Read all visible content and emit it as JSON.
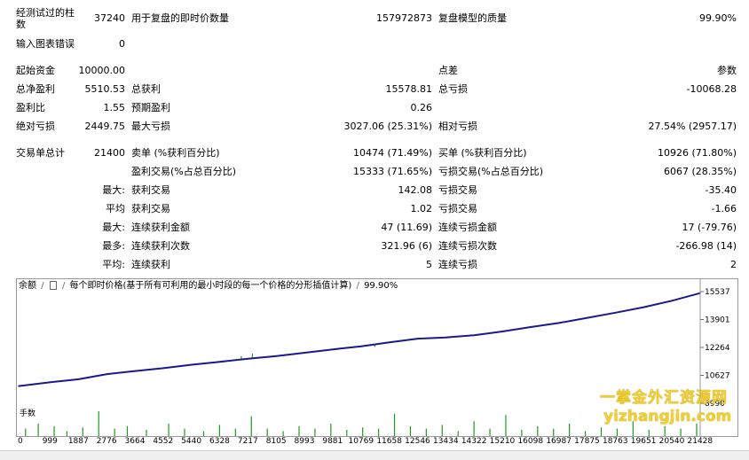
{
  "report": {
    "bars_tested_label": "经测试过的柱数",
    "bars_tested_label_line1": "经测试过的柱",
    "bars_tested_label_line2": "数",
    "bars_tested": "37240",
    "ticks_modelled_label": "用于复盘的即时价数量",
    "ticks_modelled": "157972873",
    "modelling_quality_label": "复盘模型的质量",
    "modelling_quality": "99.90%",
    "mismatched_errors_label": "输入图表错误",
    "mismatched_errors": "0",
    "initial_deposit_label": "起始资金",
    "initial_deposit": "10000.00",
    "spread_label": "点差",
    "spread": "参数",
    "total_net_profit_label": "总净盈利",
    "total_net_profit": "5510.53",
    "gross_profit_label": "总获利",
    "gross_profit": "15578.81",
    "gross_loss_label": "总亏损",
    "gross_loss": "-10068.28",
    "profit_factor_label": "盈利比",
    "profit_factor": "1.55",
    "expected_payoff_label": "预期盈利",
    "expected_payoff": "0.26",
    "absolute_drawdown_label": "绝对亏损",
    "absolute_drawdown": "2449.75",
    "maximal_drawdown_label": "最大亏损",
    "maximal_drawdown": "3027.06 (25.31%)",
    "relative_drawdown_label": "相对亏损",
    "relative_drawdown": "27.54% (2957.17)",
    "total_trades_label": "交易单总计",
    "total_trades": "21400",
    "short_positions_label": "卖单 (%获利百分比)",
    "short_positions": "10474 (71.49%)",
    "long_positions_label": "买单 (%获利百分比)",
    "long_positions": "10926 (71.80%)",
    "profit_trades_label": "盈利交易(%占总百分比)",
    "profit_trades": "15333 (71.65%)",
    "loss_trades_label": "亏损交易(%占总百分比)",
    "loss_trades": "6067 (28.35%)",
    "largest_label": "最大:",
    "largest_profit_label": "获利交易",
    "largest_profit": "142.08",
    "largest_loss_label": "亏损交易",
    "largest_loss": "-35.40",
    "average_label": "平均",
    "average_profit_label": "获利交易",
    "average_profit": "1.02",
    "average_loss_label": "亏损交易",
    "average_loss": "-1.66",
    "max_consec_label": "最大:",
    "max_consec_wins_label": "连续获利金额",
    "max_consec_wins": "47 (11.69)",
    "max_consec_losses_label": "连续亏损金额",
    "max_consec_losses": "17 (-79.76)",
    "maximal_consec_label": "最多:",
    "maximal_consec_profit_label": "连续获利次数",
    "maximal_consec_profit": "321.96 (6)",
    "maximal_consec_loss_label": "连续亏损次数",
    "maximal_consec_loss": "-266.98 (14)",
    "avg_consec_label": "平均:",
    "avg_consec_wins_label": "连续获利",
    "avg_consec_wins": "5",
    "avg_consec_losses_label": "连续亏损",
    "avg_consec_losses": "2"
  },
  "chart_header": {
    "balance": "余额",
    "model_text": "每个即时价格(基于所有可利用的最小时段的每一个价格的分形插值计算)",
    "quality": "99.90%"
  },
  "volume_label": "手数",
  "watermark": {
    "line1": "一掌金外汇资源网",
    "line2": "yizhangjin.com"
  },
  "colors": {
    "balance_line": "#1a1a8c",
    "volume_bars": "#1e9a1e",
    "drawdown_spikes": "#1e9a1e",
    "watermark": "#f2d02a"
  },
  "chart_data": {
    "type": "line",
    "title": "",
    "x_ticks": [
      "0",
      "999",
      "1887",
      "2776",
      "3664",
      "4552",
      "5440",
      "6328",
      "7217",
      "8105",
      "8993",
      "9881",
      "10769",
      "11658",
      "12546",
      "13434",
      "14322",
      "15210",
      "16098",
      "16987",
      "17875",
      "18763",
      "19651",
      "20540",
      "21428"
    ],
    "y_ticks": [
      "15537",
      "13901",
      "12264",
      "10627",
      "8990"
    ],
    "ylim": [
      8990,
      15537
    ],
    "xlim": [
      0,
      21428
    ],
    "series": [
      {
        "x": [
          0,
          999,
          1887,
          2776,
          3664,
          4552,
          5440,
          6328,
          7217,
          8105,
          8993,
          9881,
          10769,
          11658,
          12546,
          13434,
          14322,
          15210,
          16098,
          16987,
          17875,
          18763,
          19651,
          20540,
          21428
        ],
        "values": [
          10000,
          10220,
          10400,
          10700,
          10880,
          11050,
          11250,
          11420,
          11600,
          11760,
          11950,
          12150,
          12330,
          12560,
          12780,
          12850,
          12980,
          13200,
          13460,
          13700,
          14000,
          14300,
          14620,
          15000,
          15450
        ]
      }
    ],
    "spikes": [
      {
        "x": 2500,
        "low": 10627
      },
      {
        "x": 7000,
        "low": 11750
      },
      {
        "x": 7350,
        "low": 11900
      },
      {
        "x": 11200,
        "low": 12300
      }
    ],
    "volume": {
      "label": "手数",
      "x": [
        200,
        600,
        1100,
        1500,
        2000,
        2500,
        3000,
        3400,
        4000,
        4700,
        5200,
        5800,
        6300,
        6800,
        7300,
        7800,
        8300,
        8800,
        9300,
        9800,
        10300,
        10800,
        11300,
        11800,
        12300,
        12800,
        13300,
        13800,
        14300,
        14800,
        15300,
        15800,
        16300,
        16800,
        17300,
        17800,
        18300,
        18800,
        19300,
        19800,
        20300,
        20800,
        21300
      ],
      "values": [
        0.3,
        0.5,
        0.4,
        0.2,
        0.35,
        1.0,
        0.3,
        0.4,
        0.25,
        0.5,
        0.3,
        0.2,
        0.45,
        0.3,
        0.8,
        0.3,
        0.2,
        0.4,
        0.3,
        0.5,
        0.25,
        0.35,
        0.3,
        0.9,
        0.4,
        0.3,
        0.45,
        0.2,
        0.6,
        0.3,
        0.85,
        0.25,
        0.4,
        0.3,
        0.5,
        0.2,
        0.35,
        0.3,
        0.6,
        0.25,
        0.4,
        0.3,
        0.5
      ]
    }
  }
}
